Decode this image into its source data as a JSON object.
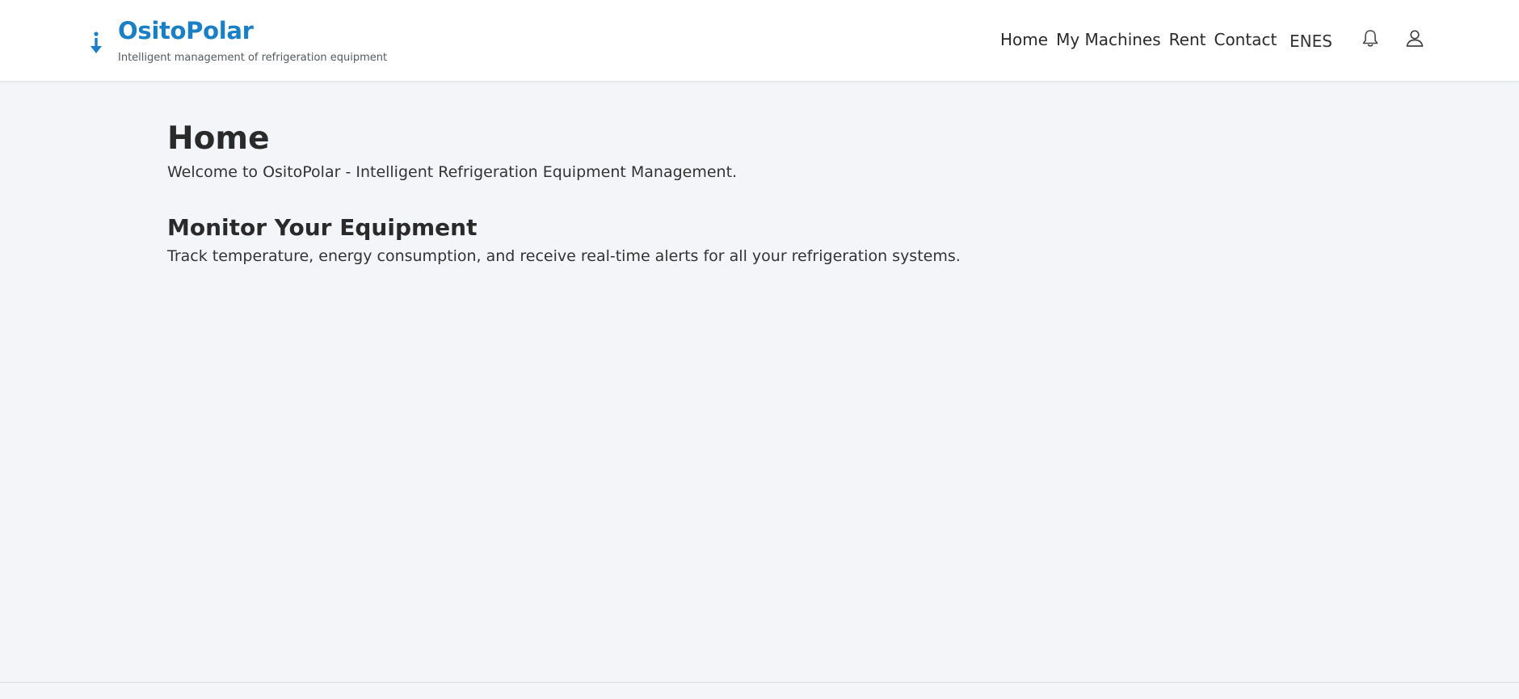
{
  "header": {
    "brand_title": "OsitoPolar",
    "brand_subtitle": "Intelligent management of refrigeration equipment",
    "brand_icon": "thermometer-down-arrow-icon",
    "nav": [
      {
        "label": "Home"
      },
      {
        "label": "My Machines"
      },
      {
        "label": "Rent"
      },
      {
        "label": "Contact"
      }
    ],
    "language": "ENES",
    "notification_icon": "bell-icon",
    "account_icon": "user-icon"
  },
  "main": {
    "title": "Home",
    "welcome": "Welcome to OsitoPolar - Intelligent Refrigeration Equipment Management.",
    "section_title": "Monitor Your Equipment",
    "section_text": "Track temperature, energy consumption, and receive real-time alerts for all your refrigeration systems."
  },
  "colors": {
    "brand": "#1a7fc4",
    "background": "#f4f5f8",
    "header_bg": "#ffffff",
    "text": "#2a2a2a"
  }
}
